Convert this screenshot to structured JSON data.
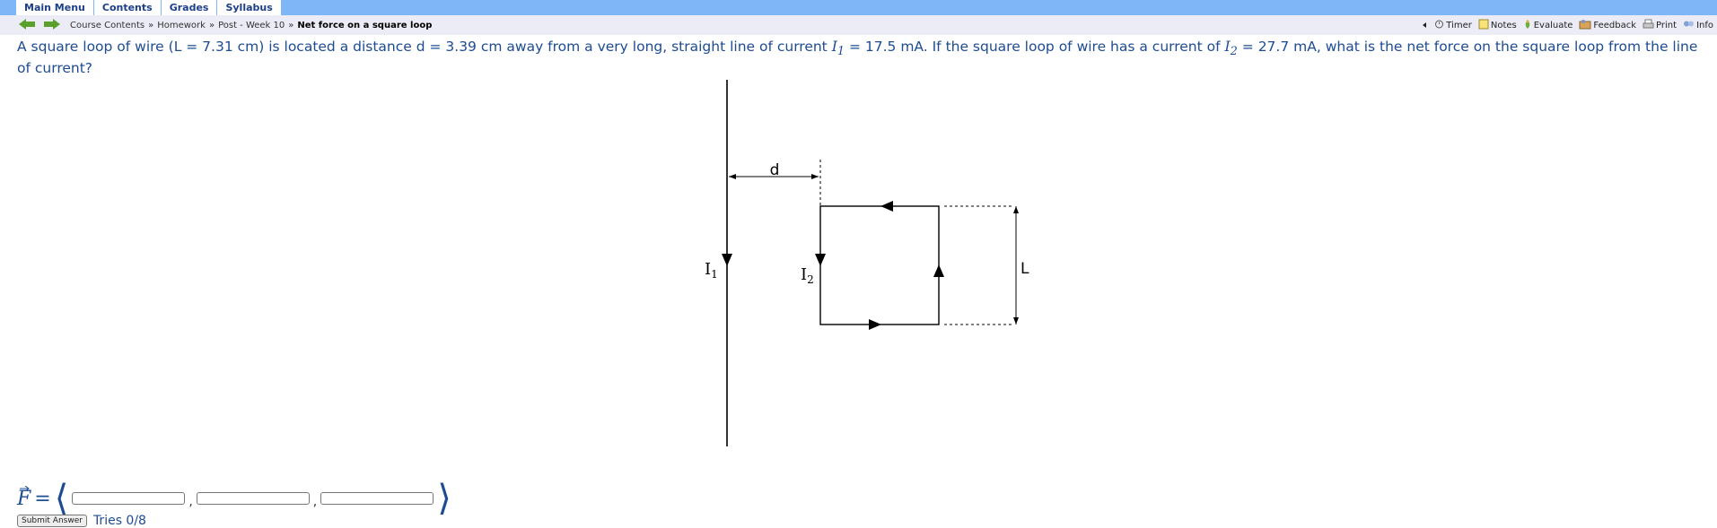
{
  "menu": {
    "tabs": [
      "Main Menu",
      "Contents",
      "Grades",
      "Syllabus"
    ]
  },
  "breadcrumb": {
    "items": [
      "Course Contents",
      "Homework",
      "Post - Week 10"
    ],
    "separator": "»",
    "current": "Net force on a square loop"
  },
  "toolbar": {
    "items": [
      {
        "label": "Timer",
        "icon": "timer-icon"
      },
      {
        "label": "Notes",
        "icon": "notes-icon"
      },
      {
        "label": "Evaluate",
        "icon": "evaluate-icon"
      },
      {
        "label": "Feedback",
        "icon": "feedback-icon"
      },
      {
        "label": "Print",
        "icon": "print-icon"
      },
      {
        "label": "Info",
        "icon": "info-icon"
      }
    ]
  },
  "problem": {
    "part1": "A square loop of wire (L = 7.31 cm) is located a distance d = 3.39 cm away from a very long, straight line of current ",
    "i1": "I",
    "i1_sub": "1",
    "part2": " = 17.5 mA. If the square loop of wire has a current of ",
    "i2": "I",
    "i2_sub": "2",
    "part3": " = 27.7 mA, what is the net force on the square loop from the line of current?"
  },
  "diagram": {
    "label_d": "d",
    "label_L": "L",
    "label_I": "I",
    "label_I1_sub": "1",
    "label_I2_sub": "2"
  },
  "answer": {
    "vector_symbol": "F",
    "equals": "=",
    "left_bracket": "⟨",
    "right_bracket": "⟩",
    "comma": ",",
    "submit_label": "Submit Answer",
    "tries": "Tries 0/8"
  },
  "colors": {
    "menubar": "#7eb6f7",
    "navbar": "#ececf6",
    "problem_text": "#1d4c94",
    "nav_arrow": "#5aa02c"
  }
}
